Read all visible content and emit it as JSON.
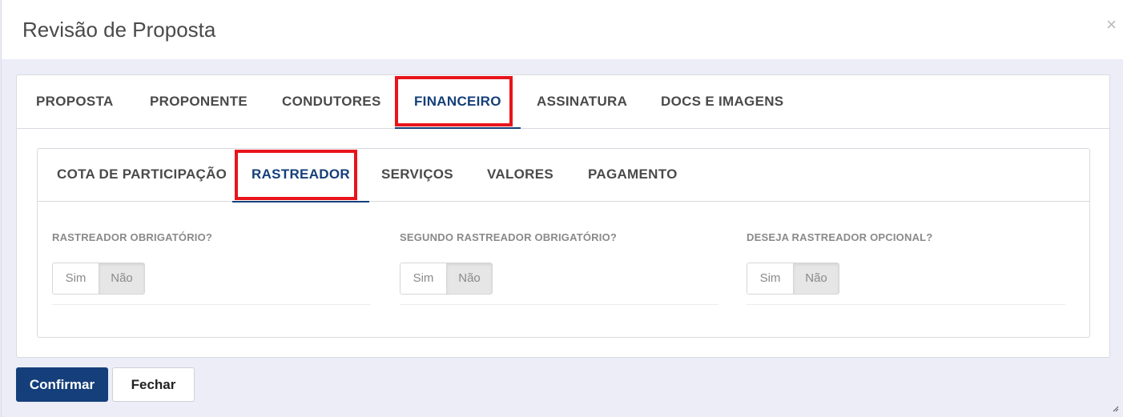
{
  "modal": {
    "title": "Revisão de Proposta",
    "close_glyph": "×"
  },
  "main_tabs": [
    {
      "label": "PROPOSTA"
    },
    {
      "label": "PROPONENTE"
    },
    {
      "label": "CONDUTORES"
    },
    {
      "label": "FINANCEIRO",
      "active": true
    },
    {
      "label": "ASSINATURA"
    },
    {
      "label": "DOCS E IMAGENS"
    }
  ],
  "sub_tabs": [
    {
      "label": "COTA DE PARTICIPAÇÃO"
    },
    {
      "label": "RASTREADOR",
      "active": true
    },
    {
      "label": "SERVIÇOS"
    },
    {
      "label": "VALORES"
    },
    {
      "label": "PAGAMENTO"
    }
  ],
  "fields": [
    {
      "label": "RASTREADOR OBRIGATÓRIO?",
      "yes": "Sim",
      "no": "Não",
      "selected": "Não"
    },
    {
      "label": "SEGUNDO RASTREADOR OBRIGATÓRIO?",
      "yes": "Sim",
      "no": "Não",
      "selected": "Não"
    },
    {
      "label": "DESEJA RASTREADOR OPCIONAL?",
      "yes": "Sim",
      "no": "Não",
      "selected": "Não"
    }
  ],
  "footer": {
    "confirm_label": "Confirmar",
    "close_label": "Fechar"
  },
  "colors": {
    "accent": "#153f7a",
    "highlight": "#e8141b",
    "backdrop": "#ecedf7"
  }
}
